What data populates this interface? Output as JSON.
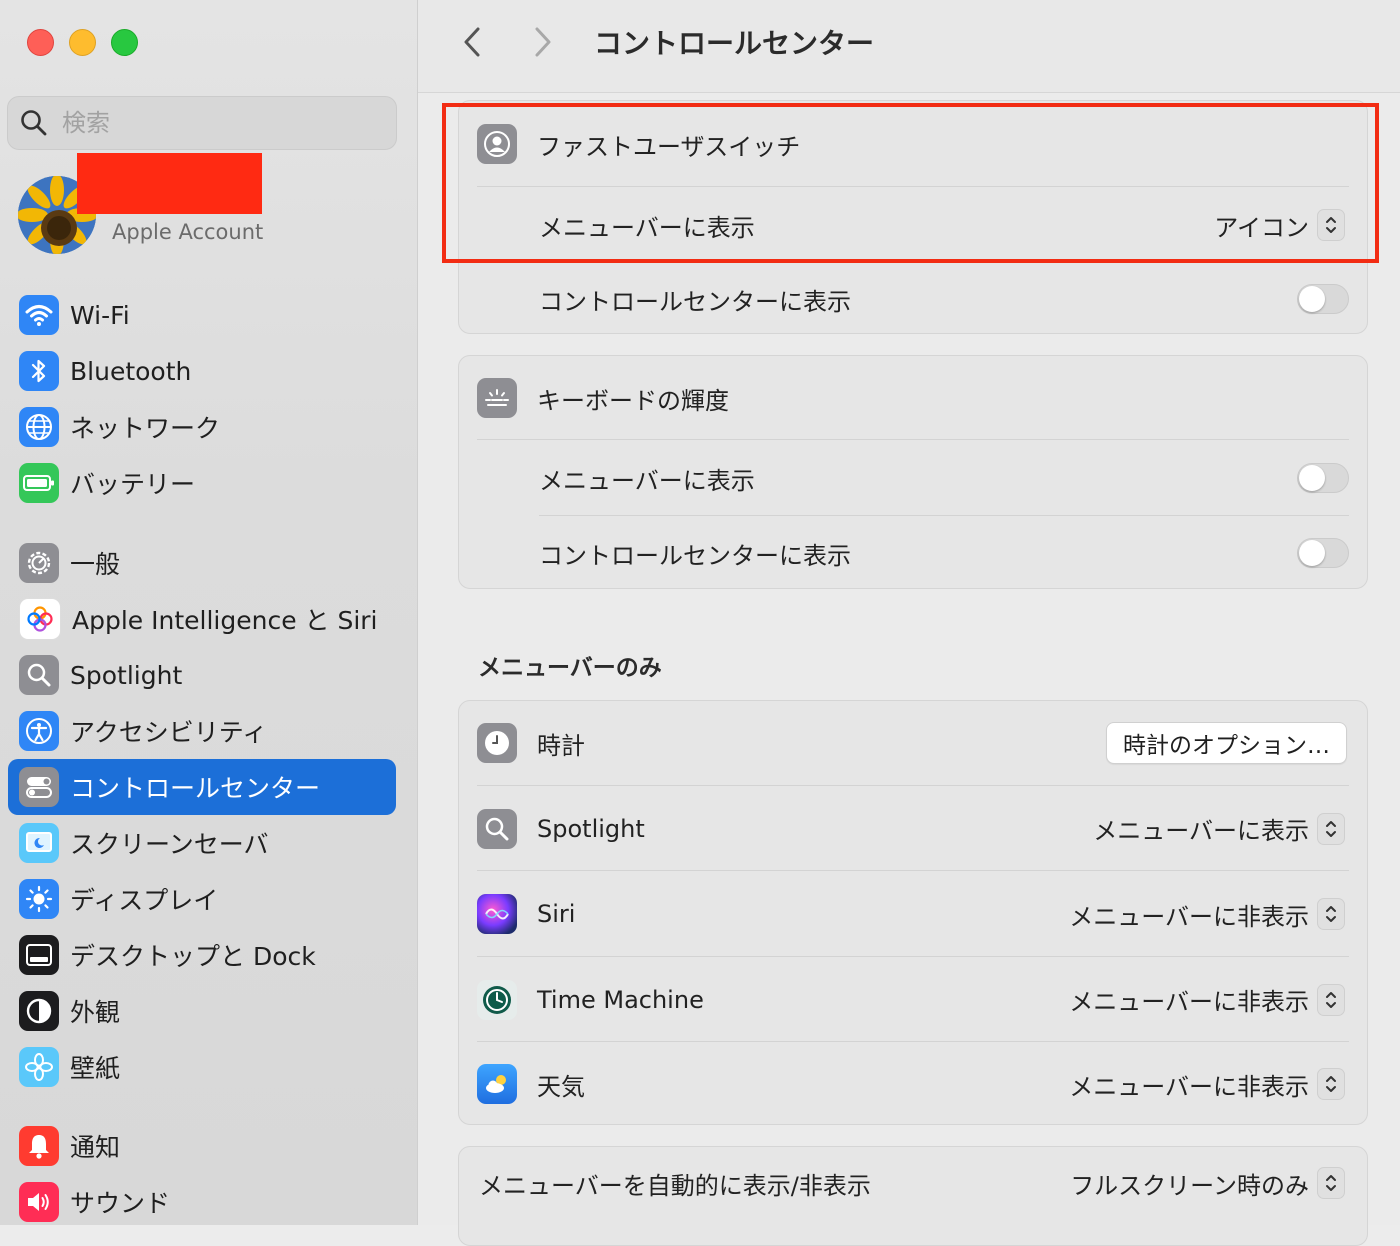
{
  "window": {
    "title": "コントロールセンター"
  },
  "search": {
    "placeholder": "検索"
  },
  "account": {
    "label": "Apple Account"
  },
  "sidebar": {
    "group1": [
      {
        "label": "Wi-Fi",
        "icon": "wifi-icon",
        "color": "#2f86f6"
      },
      {
        "label": "Bluetooth",
        "icon": "bluetooth-icon",
        "color": "#2f86f6"
      },
      {
        "label": "ネットワーク",
        "icon": "globe-icon",
        "color": "#2f86f6"
      },
      {
        "label": "バッテリー",
        "icon": "battery-icon",
        "color": "#34c759"
      }
    ],
    "group2": [
      {
        "label": "一般",
        "icon": "gear-icon",
        "color": "#8e8e93"
      },
      {
        "label": "Apple Intelligence と Siri",
        "icon": "apple-intelligence-icon",
        "color": "#ff8a65"
      },
      {
        "label": "Spotlight",
        "icon": "magnifier-icon",
        "color": "#8e8e93"
      },
      {
        "label": "アクセシビリティ",
        "icon": "accessibility-icon",
        "color": "#2f86f6"
      },
      {
        "label": "コントロールセンター",
        "icon": "control-center-icon",
        "color": "#8e8e93",
        "active": true
      },
      {
        "label": "スクリーンセーバ",
        "icon": "screensaver-icon",
        "color": "#5ac8fa"
      },
      {
        "label": "ディスプレイ",
        "icon": "sun-icon",
        "color": "#2f86f6"
      },
      {
        "label": "デスクトップと Dock",
        "icon": "dock-icon",
        "color": "#1c1c1e"
      },
      {
        "label": "外観",
        "icon": "appearance-icon",
        "color": "#1c1c1e"
      },
      {
        "label": "壁紙",
        "icon": "flower-icon",
        "color": "#5ac8fa"
      }
    ],
    "group3": [
      {
        "label": "通知",
        "icon": "bell-icon",
        "color": "#ff3b30"
      },
      {
        "label": "サウンド",
        "icon": "speaker-icon",
        "color": "#ff2d55"
      }
    ]
  },
  "fast_user": {
    "title": "ファストユーザスイッチ",
    "menubar_label": "メニューバーに表示",
    "menubar_value": "アイコン",
    "cc_label": "コントロールセンターに表示",
    "cc_on": false
  },
  "keyboard": {
    "title": "キーボードの輝度",
    "menubar_label": "メニューバーに表示",
    "menubar_on": false,
    "cc_label": "コントロールセンターに表示",
    "cc_on": false
  },
  "menubar_only": {
    "heading": "メニューバーのみ",
    "clock": {
      "label": "時計",
      "button": "時計のオプション…"
    },
    "spotlight": {
      "label": "Spotlight",
      "value": "メニューバーに表示"
    },
    "siri": {
      "label": "Siri",
      "value": "メニューバーに非表示"
    },
    "time_machine": {
      "label": "Time Machine",
      "value": "メニューバーに非表示"
    },
    "weather": {
      "label": "天気",
      "value": "メニューバーに非表示"
    }
  },
  "autohide": {
    "label": "メニューバーを自動的に表示/非表示",
    "value": "フルスクリーン時のみ"
  },
  "colors": {
    "accent": "#1c6fd8",
    "highlight": "#f22c13"
  }
}
